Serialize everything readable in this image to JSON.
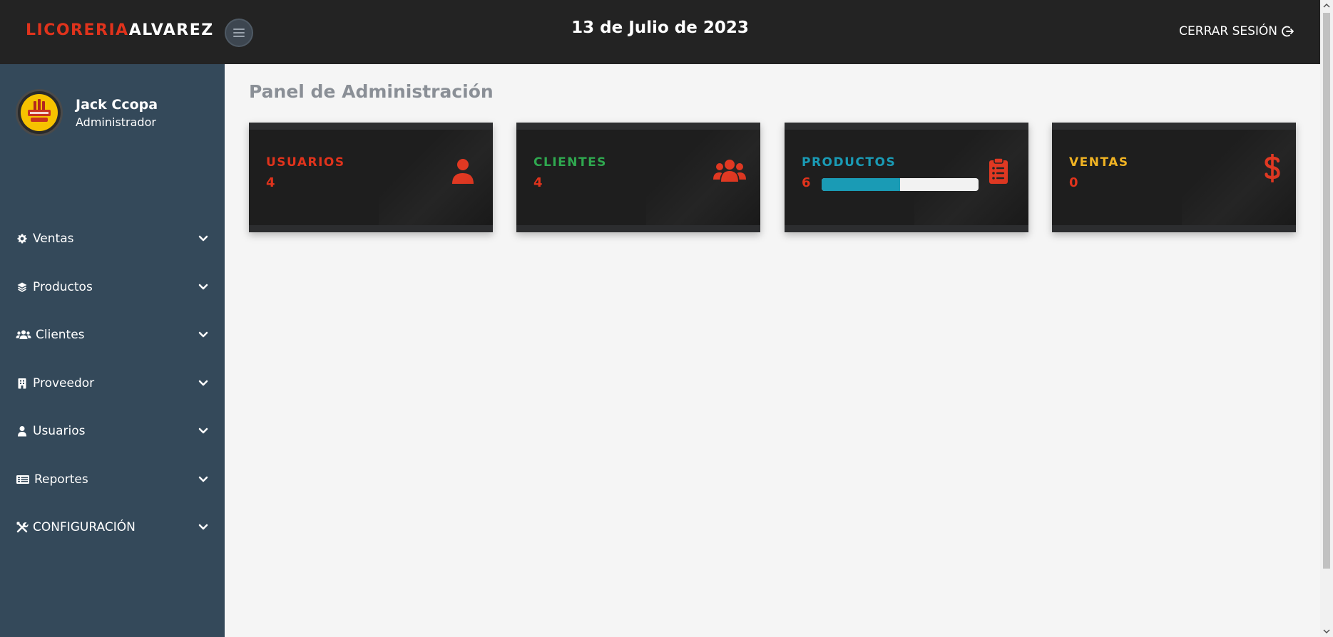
{
  "header": {
    "brand_part1": "LICORERIA",
    "brand_part2": "ALVAREZ",
    "date": "13 de Julio de 2023",
    "logout_label": "CERRAR SESIÓN",
    "menu_toggle_icon": "hamburger-icon",
    "logout_icon": "sign-out-icon"
  },
  "user": {
    "name": "Jack Ccopa",
    "role": "Administrador"
  },
  "sidebar": {
    "items": [
      {
        "label": "Ventas",
        "icon": "gear-icon"
      },
      {
        "label": "Productos",
        "icon": "layers-icon"
      },
      {
        "label": "Clientes",
        "icon": "users-icon"
      },
      {
        "label": "Proveedor",
        "icon": "building-icon"
      },
      {
        "label": "Usuarios",
        "icon": "user-icon"
      },
      {
        "label": "Reportes",
        "icon": "list-icon"
      },
      {
        "label": "CONFIGURACIÓN",
        "icon": "tools-icon"
      }
    ]
  },
  "main": {
    "title": "Panel de Administración",
    "cards": [
      {
        "title": "USUARIOS",
        "value": "4",
        "color": "#e0331c",
        "icon": "user-icon"
      },
      {
        "title": "CLIENTES",
        "value": "4",
        "color": "#2fa84f",
        "icon": "users-icon"
      },
      {
        "title": "PRODUCTOS",
        "value": "6",
        "color": "#1a9bb5",
        "icon": "clipboard-list-icon",
        "progress": 0.5
      },
      {
        "title": "VENTAS",
        "value": "0",
        "color": "#f0b323",
        "icon": "dollar-icon"
      }
    ]
  },
  "colors": {
    "accent_red": "#e0331c",
    "topbar_bg": "#232323",
    "sidebar_bg": "#34495a",
    "card_bg": "#1e1e1e"
  }
}
